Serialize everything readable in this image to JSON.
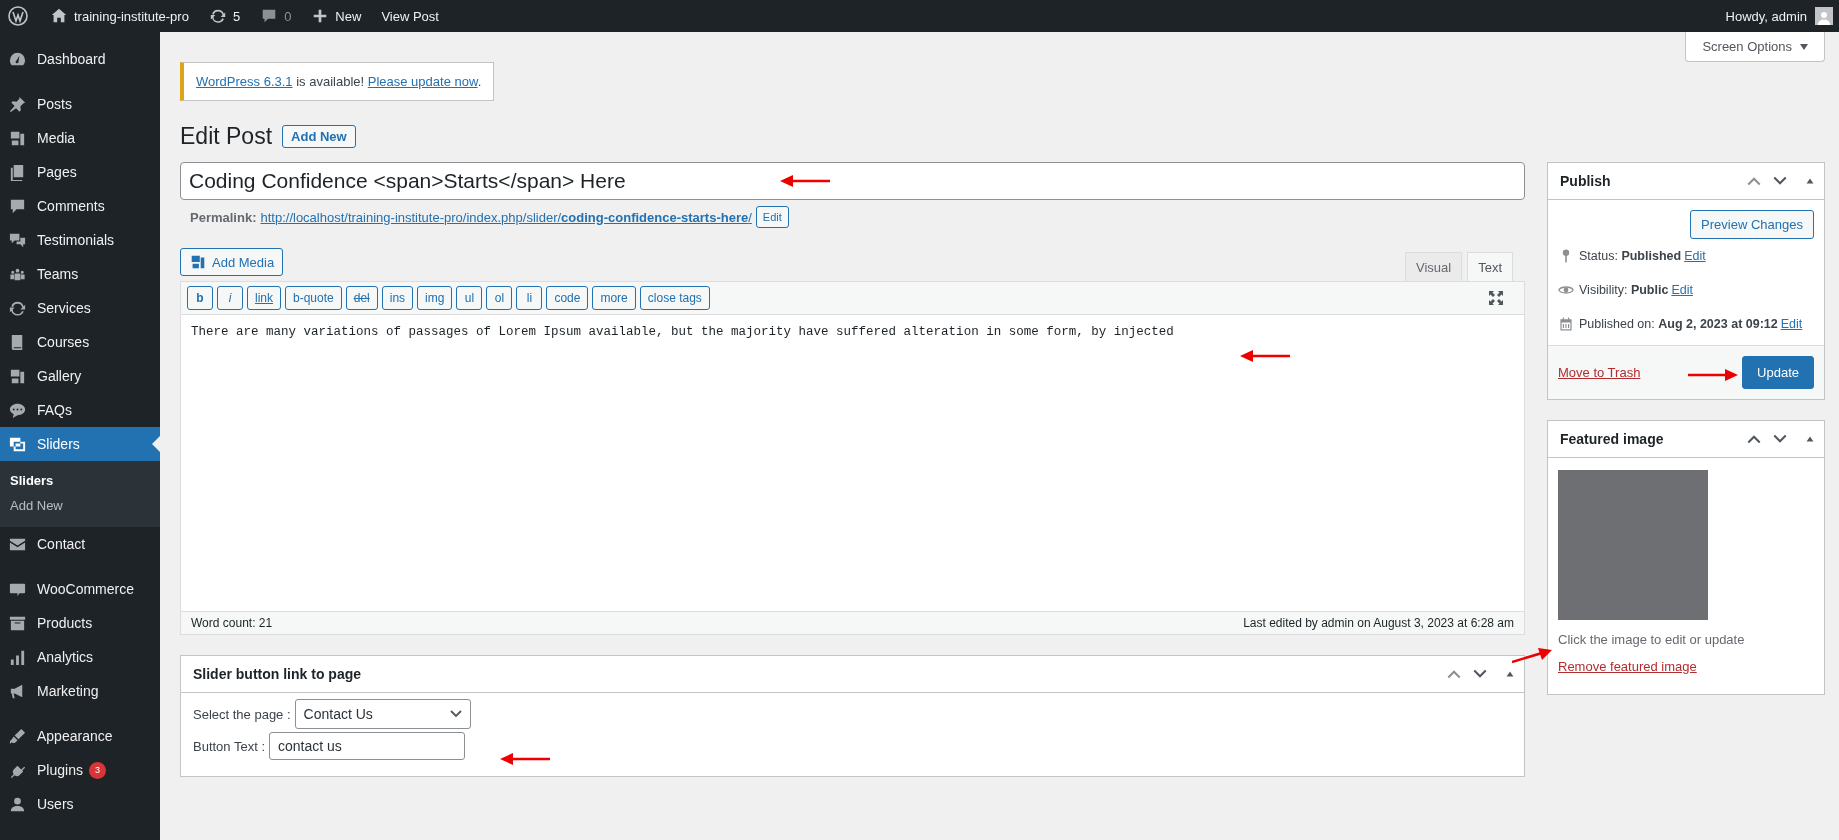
{
  "admin_bar": {
    "site": "training-institute-pro",
    "updates": "5",
    "comments": "0",
    "new": "New",
    "view": "View Post",
    "greeting": "Howdy, admin"
  },
  "sidebar": {
    "groups": [
      [
        {
          "label": "Dashboard",
          "selected": false
        }
      ],
      [
        {
          "label": "Posts",
          "selected": false
        },
        {
          "label": "Media",
          "selected": false
        },
        {
          "label": "Pages",
          "selected": false
        },
        {
          "label": "Comments",
          "selected": false
        },
        {
          "label": "Testimonials",
          "selected": false
        },
        {
          "label": "Teams",
          "selected": false
        },
        {
          "label": "Services",
          "selected": false
        },
        {
          "label": "Courses",
          "selected": false
        },
        {
          "label": "Gallery",
          "selected": false
        },
        {
          "label": "FAQs",
          "selected": false
        },
        {
          "label": "Sliders",
          "selected": true,
          "submenu": [
            {
              "label": "Sliders",
              "selected": true
            },
            {
              "label": "Add New",
              "selected": false
            }
          ]
        },
        {
          "label": "Contact",
          "selected": false
        }
      ],
      [
        {
          "label": "WooCommerce",
          "selected": false
        },
        {
          "label": "Products",
          "selected": false
        },
        {
          "label": "Analytics",
          "selected": false
        },
        {
          "label": "Marketing",
          "selected": false
        }
      ],
      [
        {
          "label": "Appearance",
          "selected": false
        },
        {
          "label": "Plugins",
          "selected": false,
          "badge": "3"
        },
        {
          "label": "Users",
          "selected": false
        }
      ]
    ]
  },
  "screen_options": "Screen Options",
  "notice": {
    "link": "WordPress 6.3.1",
    "text": " is available! ",
    "action": "Please update now",
    "end": "."
  },
  "heading": "Edit Post",
  "add_new": "Add New",
  "title": "Coding Confidence <span>Starts</span> Here",
  "permalink": {
    "label": "Permalink:",
    "url": "http://localhost/training-institute-pro/index.php/slider/**coding-confidence-starts-here**/",
    "edit": "Edit"
  },
  "add_media": "Add Media",
  "editor_tabs": [
    {
      "label": "Visual",
      "selected": false
    },
    {
      "label": "Text",
      "selected": true
    }
  ],
  "quicktags": [
    "b",
    "i",
    "link",
    "b-quote",
    "del",
    "ins",
    "img",
    "ul",
    "ol",
    "li",
    "code",
    "more",
    "close tags"
  ],
  "content": "There are many variations of passages of Lorem Ipsum available, but the majority have suffered alteration in some form, by injected",
  "word_count": "Word count: 21",
  "last_edited": "Last edited by admin on August 3, 2023 at 6:28 am",
  "slider_box": {
    "title": "Slider button link to page",
    "select_label": "Select the page :",
    "select_value": "Contact Us",
    "text_label": "Button Text :",
    "text_value": "contact us"
  },
  "publish": {
    "title": "Publish",
    "preview": "Preview Changes",
    "rows": [
      {
        "label": "Status:",
        "value": "Published",
        "edit": "Edit"
      },
      {
        "label": "Visibility:",
        "value": "Public",
        "edit": "Edit"
      },
      {
        "label": "Published on:",
        "value": "Aug 2, 2023 at 09:12",
        "edit": "Edit"
      }
    ],
    "trash": "Move to Trash",
    "update": "Update"
  },
  "featured": {
    "title": "Featured image",
    "hint": "Click the image to edit or update",
    "remove": "Remove featured image"
  }
}
